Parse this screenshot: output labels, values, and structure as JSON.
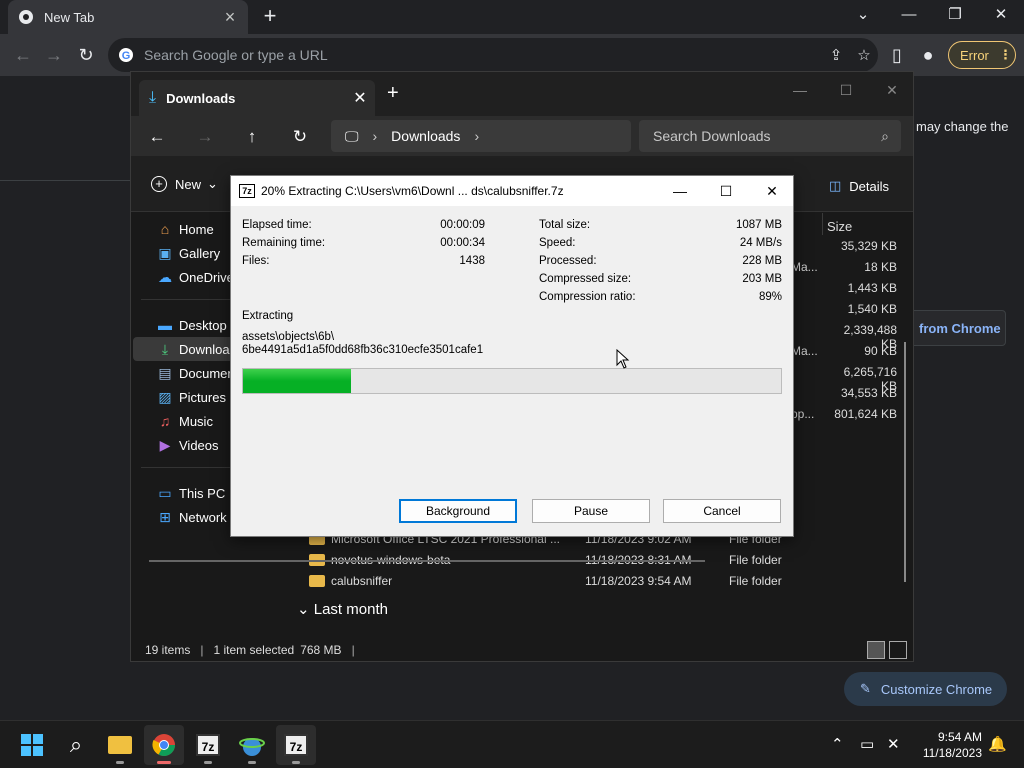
{
  "chrome": {
    "tab_title": "New Tab",
    "omnibox_placeholder": "Search Google or type a URL",
    "error_label": "Error",
    "bg_text": "may change the",
    "bg_link": "from Chrome",
    "customize_label": "Customize Chrome"
  },
  "explorer": {
    "tab_title": "Downloads",
    "breadcrumb": "Downloads",
    "search_placeholder": "Search Downloads",
    "new_label": "New",
    "details_label": "Details",
    "size_header": "Size",
    "sidebar": [
      {
        "label": "Home",
        "icon": "home-icon"
      },
      {
        "label": "Gallery",
        "icon": "gallery-icon"
      },
      {
        "label": "OneDrive",
        "icon": "cloud-icon"
      },
      {
        "label": "Desktop",
        "icon": "desktop-icon"
      },
      {
        "label": "Downloads",
        "icon": "download-icon"
      },
      {
        "label": "Documents",
        "icon": "document-icon"
      },
      {
        "label": "Pictures",
        "icon": "picture-icon"
      },
      {
        "label": "Music",
        "icon": "music-icon"
      },
      {
        "label": "Videos",
        "icon": "video-icon"
      },
      {
        "label": "This PC",
        "icon": "pc-icon"
      },
      {
        "label": "Network",
        "icon": "network-icon"
      }
    ],
    "sizes": [
      "35,329 KB",
      "18 KB",
      "1,443 KB",
      "1,540 KB",
      "2,339,488 KB",
      "90 KB",
      "6,265,716 KB",
      "34,553 KB",
      "801,624 KB"
    ],
    "truncated_cells": [
      "Ma...",
      "Ma...",
      "pp..."
    ],
    "files": [
      {
        "name": "Microsoft Office LTSC 2021 Professional ...",
        "date": "11/18/2023 9:02 AM",
        "type": "File folder"
      },
      {
        "name": "novetus-windows-beta",
        "date": "11/18/2023 8:31 AM",
        "type": "File folder"
      },
      {
        "name": "calubsniffer",
        "date": "11/18/2023 9:54 AM",
        "type": "File folder"
      }
    ],
    "group_label": "Last month",
    "status": {
      "items": "19 items",
      "selected": "1 item selected",
      "size": "768 MB"
    }
  },
  "zip": {
    "title": "20% Extracting C:\\Users\\vm6\\Downl ... ds\\calubsniffer.7z",
    "logo": "7z",
    "left_stats": [
      {
        "label": "Elapsed time:",
        "value": "00:00:09"
      },
      {
        "label": "Remaining time:",
        "value": "00:00:34"
      },
      {
        "label": "Files:",
        "value": "1438"
      }
    ],
    "right_stats": [
      {
        "label": "Total size:",
        "value": "1087 MB"
      },
      {
        "label": "Speed:",
        "value": "24 MB/s"
      },
      {
        "label": "Processed:",
        "value": "228 MB"
      },
      {
        "label": "Compressed size:",
        "value": "203 MB"
      },
      {
        "label": "Compression ratio:",
        "value": "89%"
      }
    ],
    "operation": "Extracting",
    "path_line1": "assets\\objects\\6b\\",
    "path_line2": "6be4491a5d1a5f0dd68fb36c310ecfe3501cafe1",
    "progress": 0.2,
    "buttons": {
      "background": "Background",
      "pause": "Pause",
      "cancel": "Cancel"
    }
  },
  "taskbar": {
    "time": "9:54 AM",
    "date": "11/18/2023",
    "app_7z_label": "7z"
  },
  "colors": {
    "accent": "#06b025",
    "chrome_bg": "#202124",
    "explorer_bg": "#191919"
  }
}
